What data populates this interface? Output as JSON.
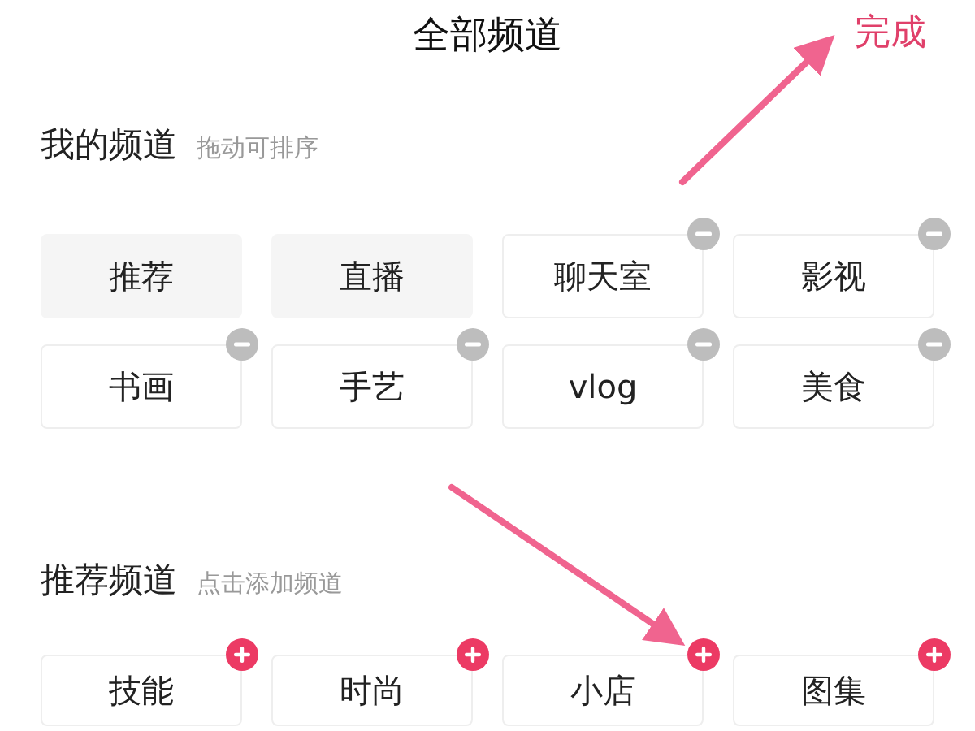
{
  "header": {
    "title": "全部频道",
    "done_button": "完成"
  },
  "my_channels": {
    "title": "我的频道",
    "hint": "拖动可排序",
    "items": [
      {
        "label": "推荐",
        "kind": "fixed"
      },
      {
        "label": "直播",
        "kind": "fixed"
      },
      {
        "label": "聊天室",
        "kind": "removable"
      },
      {
        "label": "影视",
        "kind": "removable"
      },
      {
        "label": "书画",
        "kind": "removable"
      },
      {
        "label": "手艺",
        "kind": "removable"
      },
      {
        "label": "vlog",
        "kind": "removable"
      },
      {
        "label": "美食",
        "kind": "removable"
      }
    ]
  },
  "recommended_channels": {
    "title": "推荐频道",
    "hint": "点击添加频道",
    "items": [
      {
        "label": "技能",
        "kind": "addable"
      },
      {
        "label": "时尚",
        "kind": "addable"
      },
      {
        "label": "小店",
        "kind": "addable"
      },
      {
        "label": "图集",
        "kind": "addable"
      }
    ]
  }
}
